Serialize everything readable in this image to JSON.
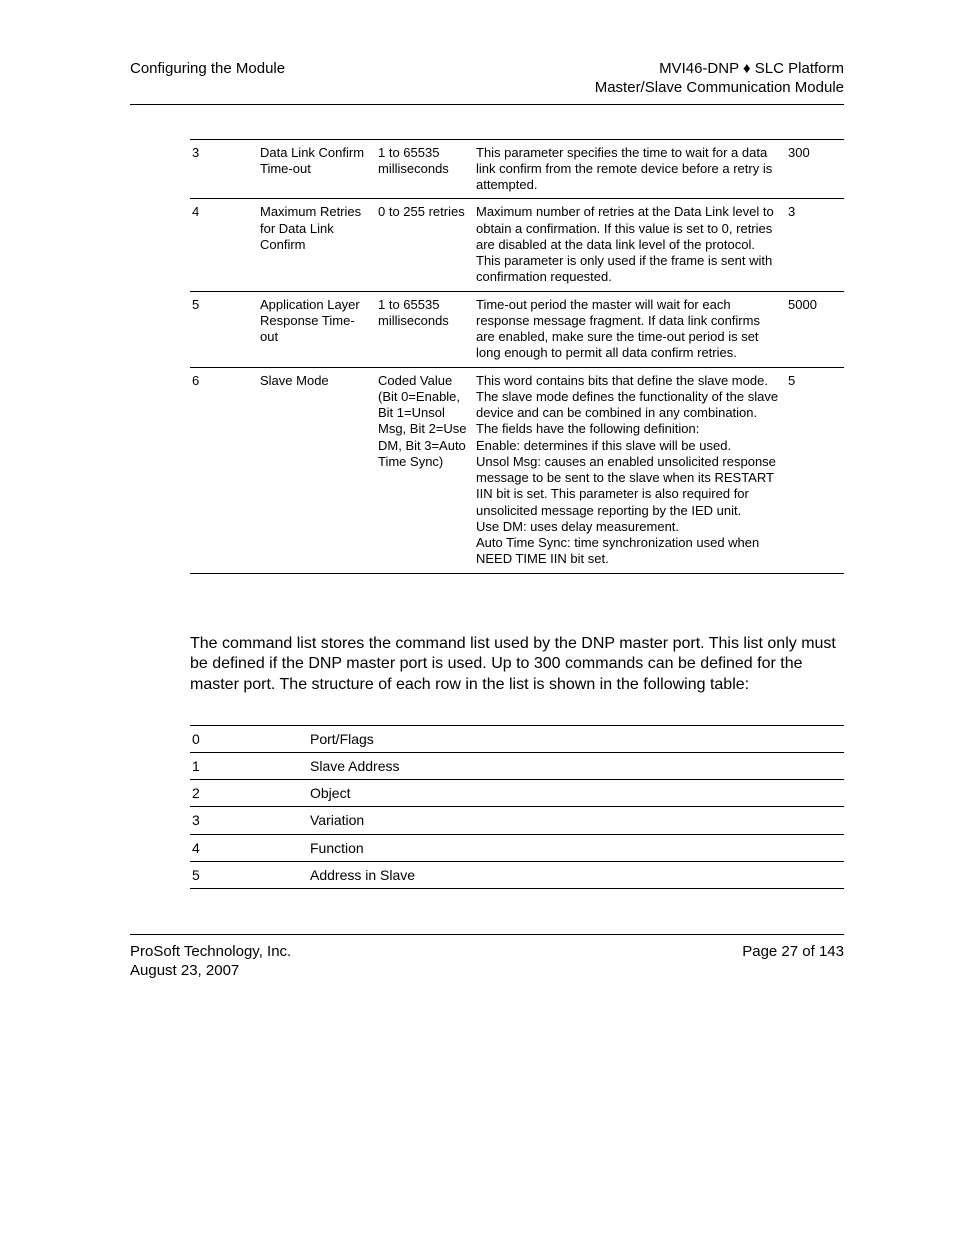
{
  "header": {
    "left": "Configuring the Module",
    "right_line1": "MVI46-DNP ♦ SLC Platform",
    "right_line2": "Master/Slave Communication Module"
  },
  "param_table": {
    "rows": [
      {
        "idx": "3",
        "name": "Data Link Confirm Time-out",
        "range": "1 to 65535 milliseconds",
        "desc": "This parameter specifies the time to wait for a data link confirm from the remote device before a retry is attempted.",
        "def": "300"
      },
      {
        "idx": "4",
        "name": "Maximum Retries for Data Link Confirm",
        "range": "0 to 255 retries",
        "desc": "Maximum number of retries at the Data Link level to obtain a confirmation. If this value is set to 0, retries are disabled at the data link level of the protocol. This parameter is only used if the frame is sent with confirmation requested.",
        "def": "3"
      },
      {
        "idx": "5",
        "name": "Application Layer Response Time-out",
        "range": "1 to 65535 milliseconds",
        "desc": "Time-out period the master will wait for each response message fragment. If data link confirms are enabled, make sure the time-out period is set long enough to permit all data confirm retries.",
        "def": "5000"
      },
      {
        "idx": "6",
        "name": "Slave Mode",
        "range": "Coded Value (Bit 0=Enable, Bit 1=Unsol Msg, Bit 2=Use DM, Bit 3=Auto Time Sync)",
        "desc": "This word contains bits that define the slave mode. The slave mode defines the functionality of the slave device and can be combined in any combination. The fields have the following definition:\nEnable: determines if this slave will be used.\nUnsol Msg: causes an enabled unsolicited response message to be sent to the slave when its RESTART IIN bit is set. This parameter is also required for unsolicited message reporting by the IED unit.\nUse DM: uses delay measurement.\nAuto Time Sync: time synchronization used when NEED TIME IIN bit set.",
        "def": "5"
      }
    ]
  },
  "paragraph": "The command list stores the command list used by the DNP master port. This list only must be defined if the DNP master port is used. Up to 300 commands can be defined for the master port. The structure of each row in the list is shown in the following table:",
  "cmd_table": {
    "rows": [
      {
        "idx": "0",
        "label": "Port/Flags"
      },
      {
        "idx": "1",
        "label": "Slave Address"
      },
      {
        "idx": "2",
        "label": "Object"
      },
      {
        "idx": "3",
        "label": "Variation"
      },
      {
        "idx": "4",
        "label": "Function"
      },
      {
        "idx": "5",
        "label": "Address in Slave"
      }
    ]
  },
  "footer": {
    "company": "ProSoft Technology, Inc.",
    "date": "August 23, 2007",
    "page": "Page 27 of 143"
  }
}
